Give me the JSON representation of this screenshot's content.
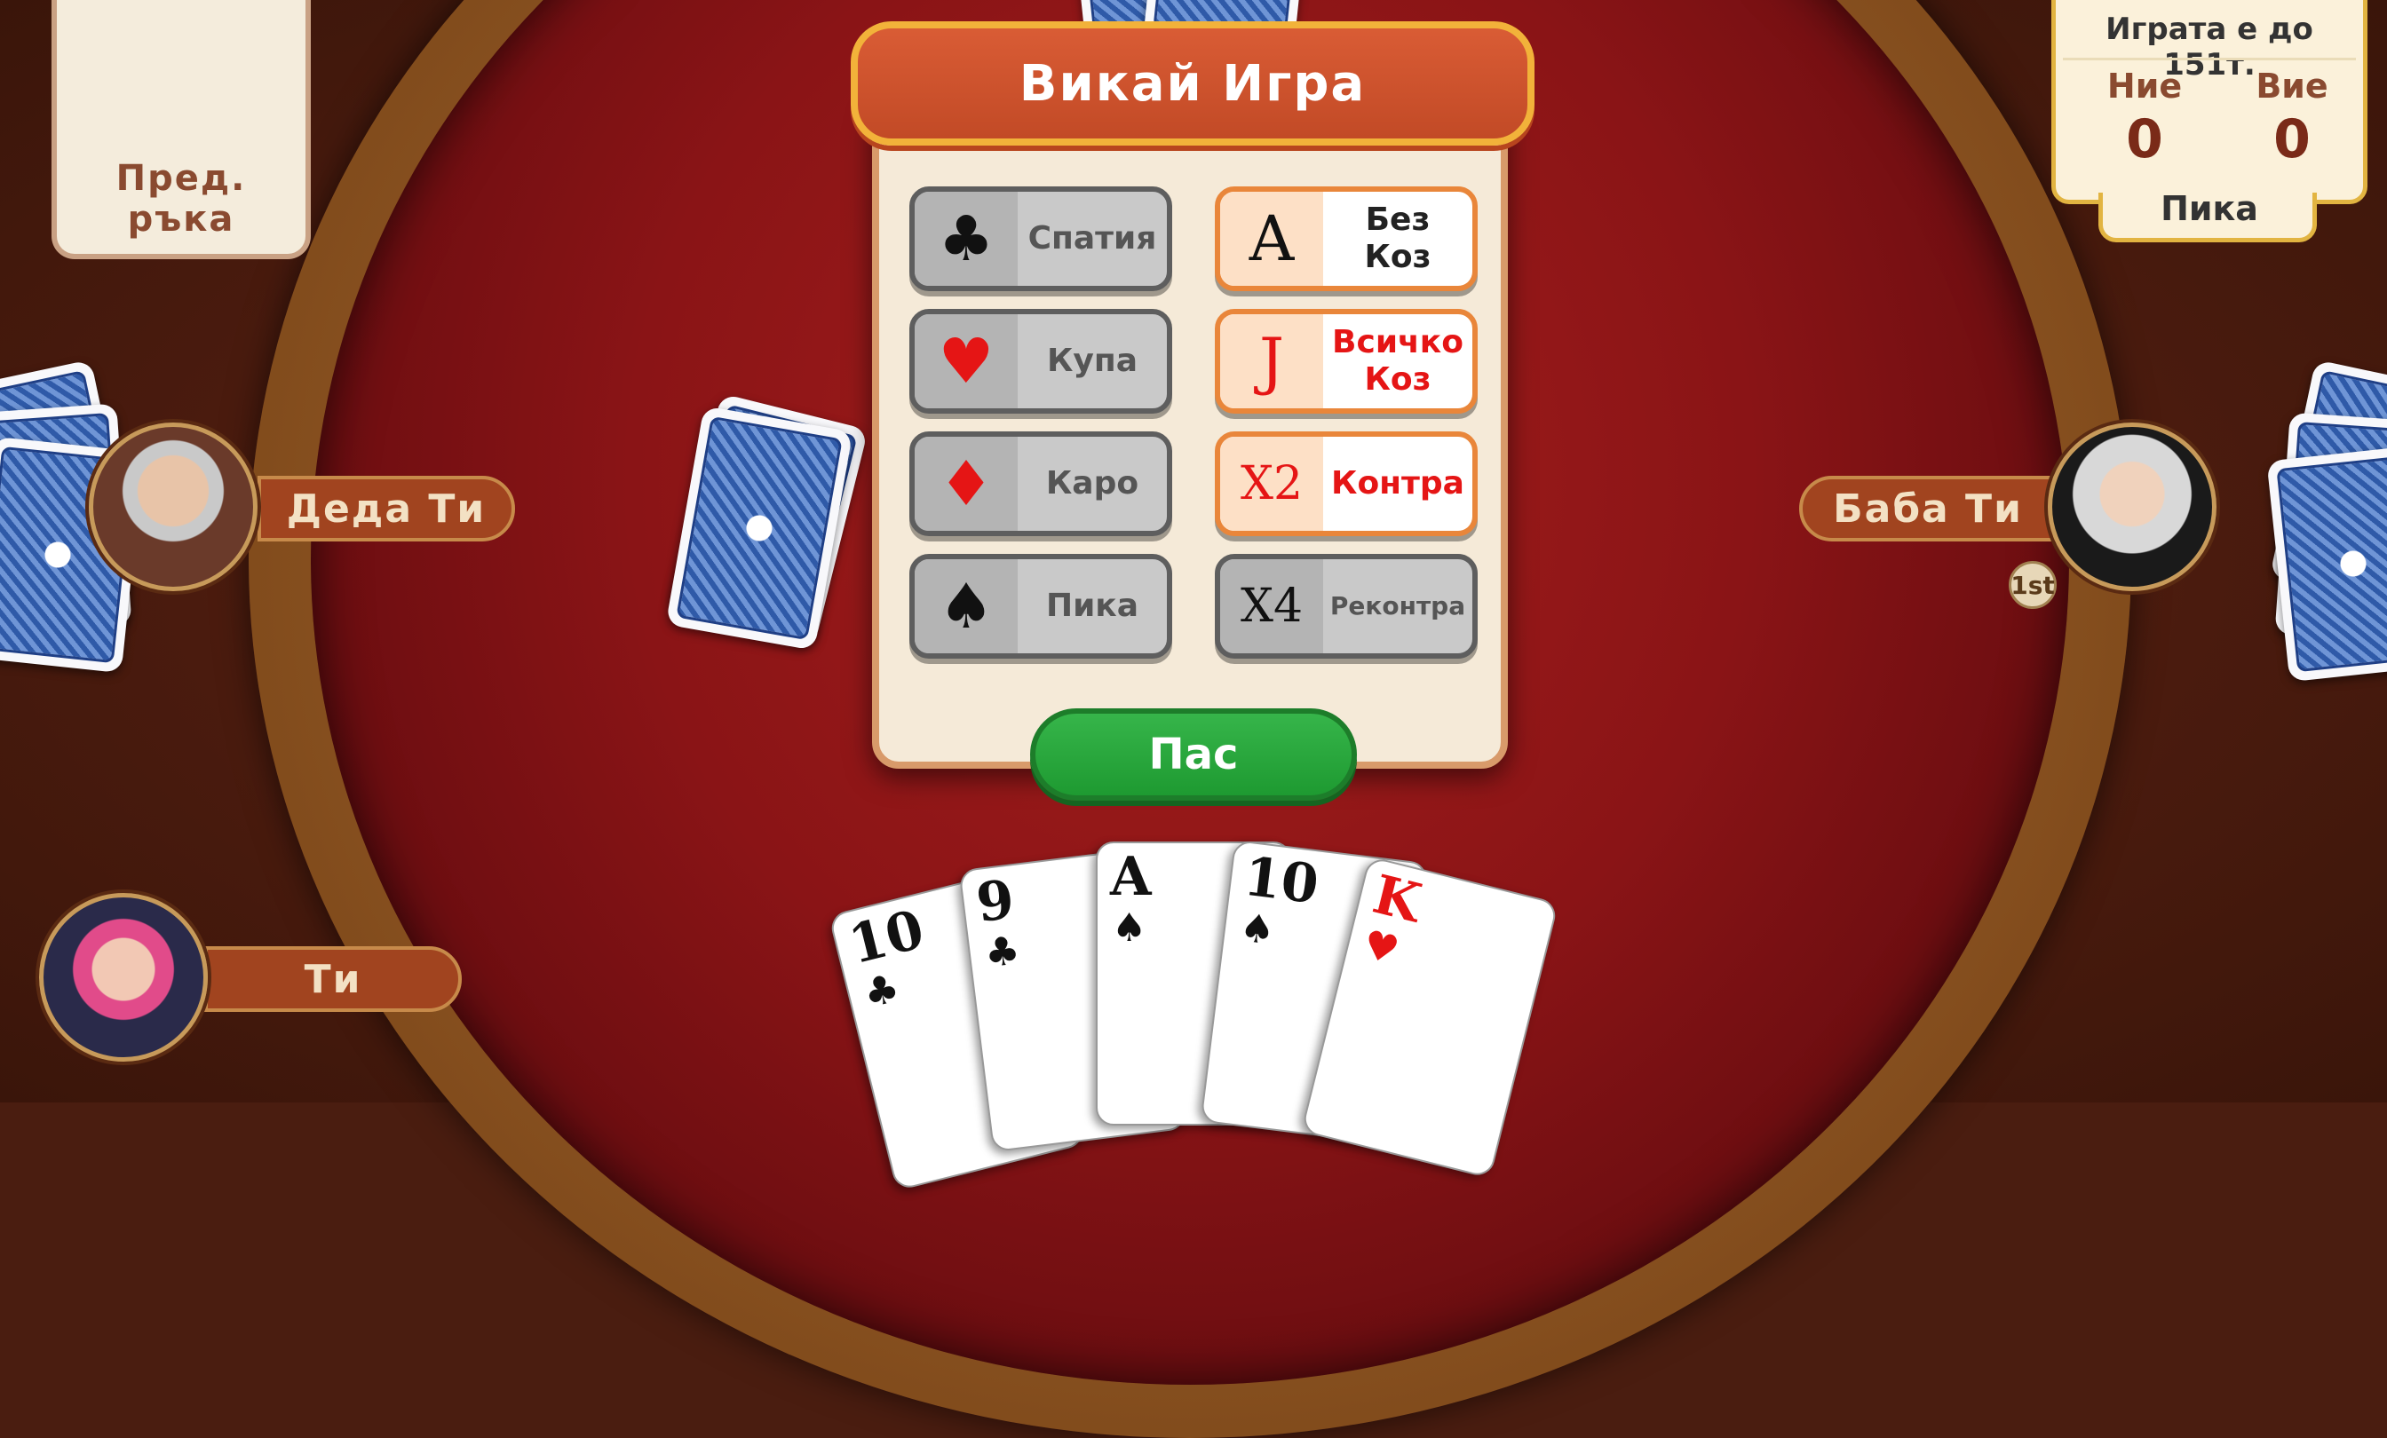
{
  "prev_hand": {
    "label": "Пред. ръка"
  },
  "score": {
    "title": "Играта е до 151т.",
    "us_label": "Ние",
    "them_label": "Вие",
    "us_score": "0",
    "them_score": "0",
    "trump": "Пика"
  },
  "players": {
    "left": {
      "name": "Деда Ти"
    },
    "right": {
      "name": "Баба Ти",
      "badge": "1st"
    },
    "me": {
      "name": "Ти"
    }
  },
  "dialog": {
    "title": "Викай Игра",
    "options": [
      {
        "icon": "♣",
        "label": "Спатия"
      },
      {
        "icon": "A",
        "label": "Без\nКоз"
      },
      {
        "icon": "♥",
        "label": "Купа"
      },
      {
        "icon": "J",
        "label": "Всичко\nКоз"
      },
      {
        "icon": "♦",
        "label": "Каро"
      },
      {
        "icon": "X2",
        "label": "Контра"
      },
      {
        "icon": "♠",
        "label": "Пика"
      },
      {
        "icon": "X4",
        "label": "Реконтра"
      }
    ],
    "pass_label": "Пас"
  },
  "hand": [
    {
      "rank": "10",
      "suit": "♣"
    },
    {
      "rank": "9",
      "suit": "♣"
    },
    {
      "rank": "A",
      "suit": "♠"
    },
    {
      "rank": "10",
      "suit": "♠"
    },
    {
      "rank": "K",
      "suit": "♥"
    }
  ],
  "colors": {
    "felt": "#8a1416",
    "accent": "#e2b441",
    "pass": "#1e9a31"
  }
}
